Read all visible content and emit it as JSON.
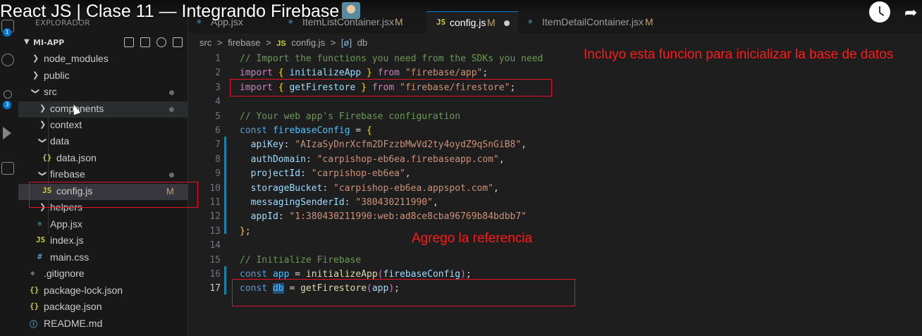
{
  "video": {
    "title": "React JS | Clase 11 — Integrando Firebase"
  },
  "activity_bar": {
    "badges": [
      "1",
      "3"
    ]
  },
  "sidebar": {
    "header": "EXPLORADOR",
    "root": "MI-APP",
    "items": [
      {
        "name": "node_modules",
        "type": "folder",
        "open": false
      },
      {
        "name": "public",
        "type": "folder",
        "open": false
      },
      {
        "name": "src",
        "type": "folder",
        "open": true
      },
      {
        "name": "components",
        "type": "folder",
        "open": false
      },
      {
        "name": "context",
        "type": "folder",
        "open": false
      },
      {
        "name": "data",
        "type": "folder",
        "open": true
      },
      {
        "name": "data.json",
        "type": "json",
        "icon": "{}"
      },
      {
        "name": "firebase",
        "type": "folder",
        "open": true
      },
      {
        "name": "config.js",
        "type": "js",
        "icon": "JS",
        "status": "M"
      },
      {
        "name": "helpers",
        "type": "folder",
        "open": false
      },
      {
        "name": "App.jsx",
        "type": "react"
      },
      {
        "name": "index.js",
        "type": "js",
        "icon": "JS"
      },
      {
        "name": "main.css",
        "type": "css",
        "icon": "#"
      },
      {
        "name": ".gitignore",
        "type": "git"
      },
      {
        "name": "package-lock.json",
        "type": "json",
        "icon": "{}"
      },
      {
        "name": "package.json",
        "type": "json",
        "icon": "{}"
      },
      {
        "name": "README.md",
        "type": "md"
      }
    ]
  },
  "tabs": [
    {
      "name": "App.jsx"
    },
    {
      "name": "ItemListContainer.jsx",
      "status": "M"
    },
    {
      "name": "config.js",
      "icon": "JS",
      "status": "M",
      "active": true
    },
    {
      "name": "ItemDetailContainer.jsx",
      "status": "M"
    }
  ],
  "breadcrumb": [
    "src",
    ">",
    "firebase",
    ">",
    "JS",
    "config.js",
    ">",
    "[ø]",
    "db"
  ],
  "code": {
    "current_line": 17,
    "lines": [
      "// Import the functions you need from the SDKs you need",
      "import { initializeApp } from \"firebase/app\";",
      "import { getFirestore } from \"firebase/firestore\";",
      "",
      "// Your web app's Firebase configuration",
      "const firebaseConfig = {",
      "  apiKey: \"AIzaSyDnrXcfm2DFzzbMwVd2ty4oydZ9qSnGiB8\",",
      "  authDomain: \"carpishop-eb6ea.firebaseapp.com\",",
      "  projectId: \"carpishop-eb6ea\",",
      "  storageBucket: \"carpishop-eb6ea.appspot.com\",",
      "  messagingSenderId: \"380430211990\",",
      "  appId: \"1:380430211990:web:ad8ce8cba96769b84bdbb7\"",
      "};",
      "",
      "// Initialize Firebase",
      "const app = initializeApp(firebaseConfig);",
      "const db = getFirestore(app);"
    ],
    "line_numbers": [
      "1",
      "2",
      "3",
      "4",
      "5",
      "6",
      "7",
      "8",
      "9",
      "10",
      "11",
      "12",
      "13",
      "14",
      "15",
      "16",
      "17"
    ]
  },
  "annotations": {
    "note1": "Incluyo esta funcion para inicializar la base de datos",
    "note2": "Agrego la referencia",
    "color": "#ff1a1a"
  },
  "colors": {
    "editor_bg": "#1e1e1e",
    "sidebar_bg": "#181818",
    "accent": "#0078d4",
    "modified": "#c0a26a"
  }
}
